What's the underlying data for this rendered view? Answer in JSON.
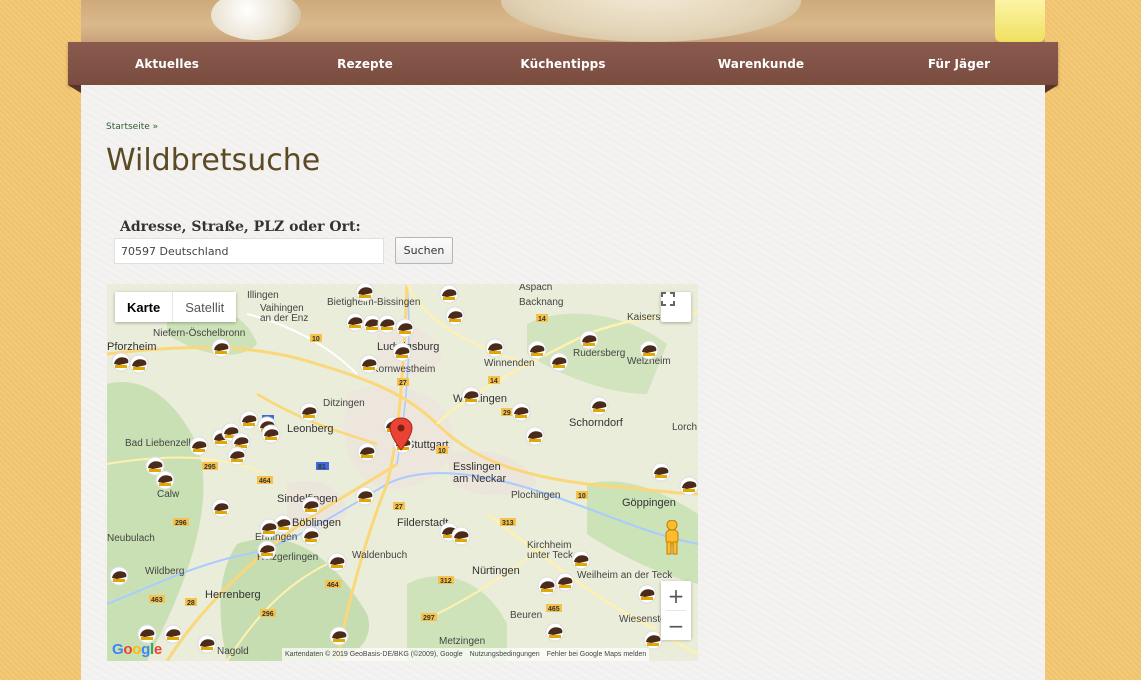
{
  "nav": {
    "items": [
      "Aktuelles",
      "Rezepte",
      "Küchentipps",
      "Warenkunde",
      "Für Jäger"
    ]
  },
  "breadcrumb": "Startseite »",
  "page_title": "Wildbretsuche",
  "search": {
    "label": "Adresse, Straße, PLZ oder Ort:",
    "value": "70597 Deutschland",
    "button": "Suchen"
  },
  "map": {
    "type_buttons": [
      "Karte",
      "Satellit"
    ],
    "active_type": "Karte",
    "footer": [
      "Kartendaten © 2019 GeoBasis-DE/BKG (©2009), Google",
      "Nutzungsbedingungen",
      "Fehler bei Google Maps melden"
    ],
    "logo": "Google",
    "zoom_in": "+",
    "zoom_out": "−",
    "places": [
      "Bietigheim-Bissingen",
      "Backnang",
      "Vaihingen an der Enz",
      "Kaisersbach",
      "Niefern-Öschelbronn",
      "Pforzheim",
      "Ludwigsburg",
      "Rudersberg",
      "Welzheim",
      "Kornwestheim",
      "Winnenden",
      "Ditzingen",
      "Waiblingen",
      "Schorndorf",
      "Lorch",
      "Leonberg",
      "Bad Liebenzell",
      "Stuttgart",
      "Esslingen am Neckar",
      "Calw",
      "Plochingen",
      "Göppingen",
      "Sindelfingen",
      "Böblingen",
      "Filderstadt",
      "Neubulach",
      "Ehningen",
      "Kirchheim unter Teck",
      "Holzgerlingen",
      "Waldenbuch",
      "Wildberg",
      "Nürtingen",
      "Weilheim an der Teck",
      "Herrenberg",
      "Beuren",
      "Wiesensteig",
      "Metzingen",
      "Aspach",
      "Illingen",
      "Nagold"
    ],
    "roads": [
      "10",
      "14",
      "27",
      "29",
      "8",
      "81",
      "295",
      "464",
      "296",
      "313",
      "312",
      "463",
      "28",
      "297",
      "465"
    ]
  }
}
